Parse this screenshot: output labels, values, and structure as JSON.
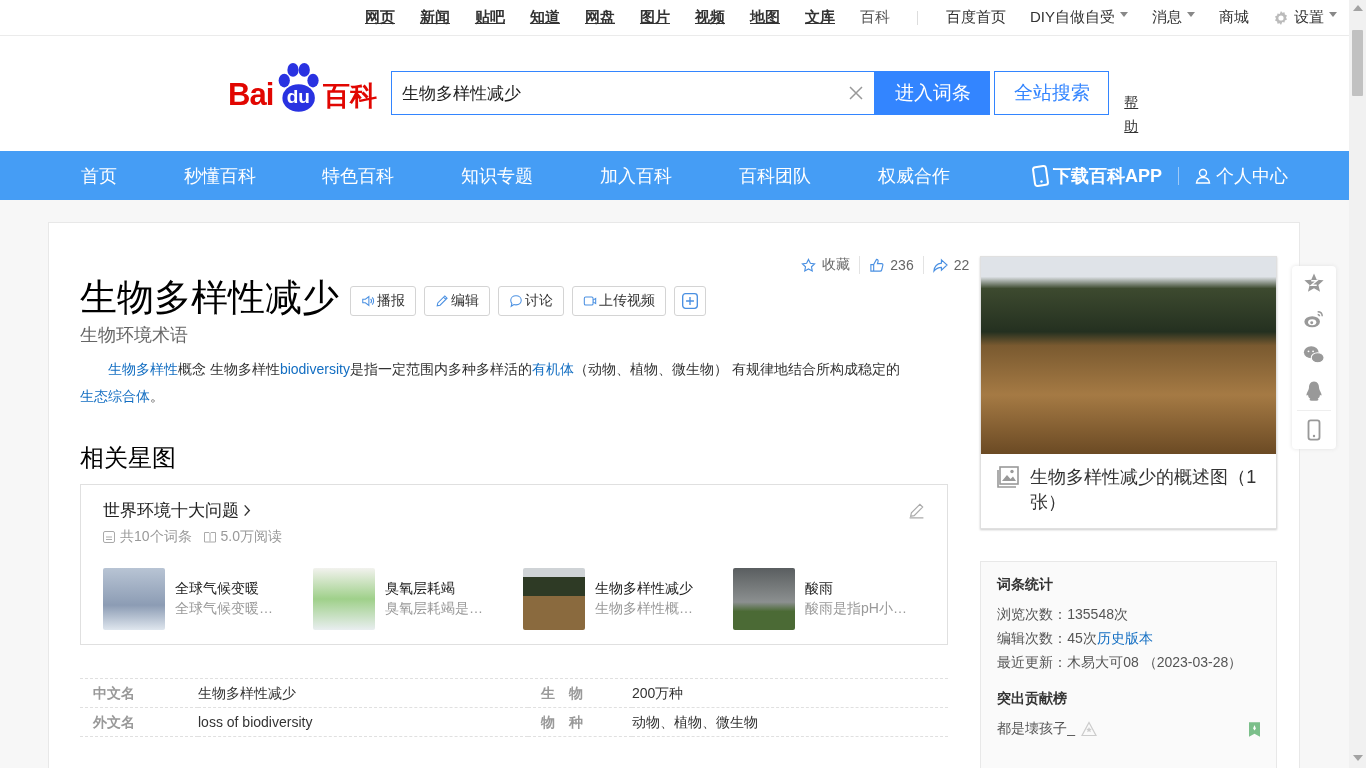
{
  "top_bar": {
    "links": [
      {
        "label": "网页",
        "selected": false
      },
      {
        "label": "新闻",
        "selected": false
      },
      {
        "label": "贴吧",
        "selected": false
      },
      {
        "label": "知道",
        "selected": false
      },
      {
        "label": "网盘",
        "selected": false
      },
      {
        "label": "图片",
        "selected": false
      },
      {
        "label": "视频",
        "selected": false
      },
      {
        "label": "地图",
        "selected": false
      },
      {
        "label": "文库",
        "selected": false
      },
      {
        "label": "百科",
        "selected": true
      }
    ],
    "menus": [
      {
        "label": "百度首页",
        "kind": "plain",
        "has_menu": false
      },
      {
        "label": "DIY自做自受",
        "kind": "plain",
        "has_menu": true
      },
      {
        "label": "消息",
        "kind": "plain",
        "has_menu": true
      },
      {
        "label": "商城",
        "kind": "plain",
        "has_menu": false
      },
      {
        "label": "设置",
        "kind": "settings",
        "has_menu": true
      }
    ]
  },
  "header": {
    "logo": {
      "text_1": "Bai",
      "paw_text": "du",
      "text_2": "百科"
    },
    "search": {
      "value": "生物多样性减少"
    },
    "buttons": [
      {
        "label": "进入词条",
        "kind": "primary"
      },
      {
        "label": "全站搜索",
        "kind": "secondary"
      }
    ],
    "help": "帮助"
  },
  "nav": {
    "items": [
      "首页",
      "秒懂百科",
      "特色百科",
      "知识专题",
      "加入百科",
      "百科团队",
      "权威合作"
    ],
    "app": "下载百科APP",
    "user": "个人中心"
  },
  "article": {
    "stats": {
      "collect": "收藏",
      "likes": "236",
      "shares": "22"
    },
    "title": "生物多样性减少",
    "actions": [
      {
        "kind": "audio",
        "label": "播报"
      },
      {
        "kind": "edit",
        "label": "编辑"
      },
      {
        "kind": "discuss",
        "label": "讨论"
      },
      {
        "kind": "video",
        "label": "上传视频"
      },
      {
        "kind": "add"
      }
    ],
    "subtitle": "生物环境术语",
    "summary": [
      {
        "text": "生物多样性",
        "link": true
      },
      {
        "text": "概念 生物多样性",
        "link": false
      },
      {
        "text": "biodiversity",
        "link": true
      },
      {
        "text": "是指一定范围内多种多样活的",
        "link": false
      },
      {
        "text": "有机体",
        "link": true
      },
      {
        "text": "（动物、植物、微生物） 有规律地结合所构成稳定的",
        "link": false
      },
      {
        "text": "生态综合体",
        "link": true
      },
      {
        "text": "。",
        "link": false
      }
    ],
    "star_map": {
      "heading": "相关星图",
      "title": "世界环境十大问题",
      "count": "共10个词条",
      "reads": "5.0万阅读",
      "items": [
        {
          "title": "全球气候变暖",
          "desc": "全球气候变暖…"
        },
        {
          "title": "臭氧层耗竭",
          "desc": "臭氧层耗竭是…"
        },
        {
          "title": "生物多样性减少",
          "desc": "生物多样性概…"
        },
        {
          "title": "酸雨",
          "desc": "酸雨是指pH小…"
        }
      ]
    },
    "basic_info": [
      {
        "label": "中文名",
        "value": "生物多样性减少"
      },
      {
        "label": "生　物",
        "value": "200万种"
      },
      {
        "label": "外文名",
        "value": "loss of biodiversity"
      },
      {
        "label": "物　种",
        "value": "动物、植物、微生物"
      }
    ]
  },
  "sidebar": {
    "album": {
      "caption": "生物多样性减少的概述图（1张）"
    },
    "stats": {
      "title": "词条统计",
      "lines": [
        {
          "label": "浏览次数：",
          "value": "135548次"
        },
        {
          "label": "编辑次数：",
          "value": "45次",
          "link": "历史版本"
        },
        {
          "label": "最近更新：",
          "value": "木易大可08 （2023-03-28）"
        }
      ]
    },
    "contributors": {
      "title": "突出贡献榜",
      "items": [
        {
          "name": "都是壊孩子_"
        }
      ]
    }
  }
}
